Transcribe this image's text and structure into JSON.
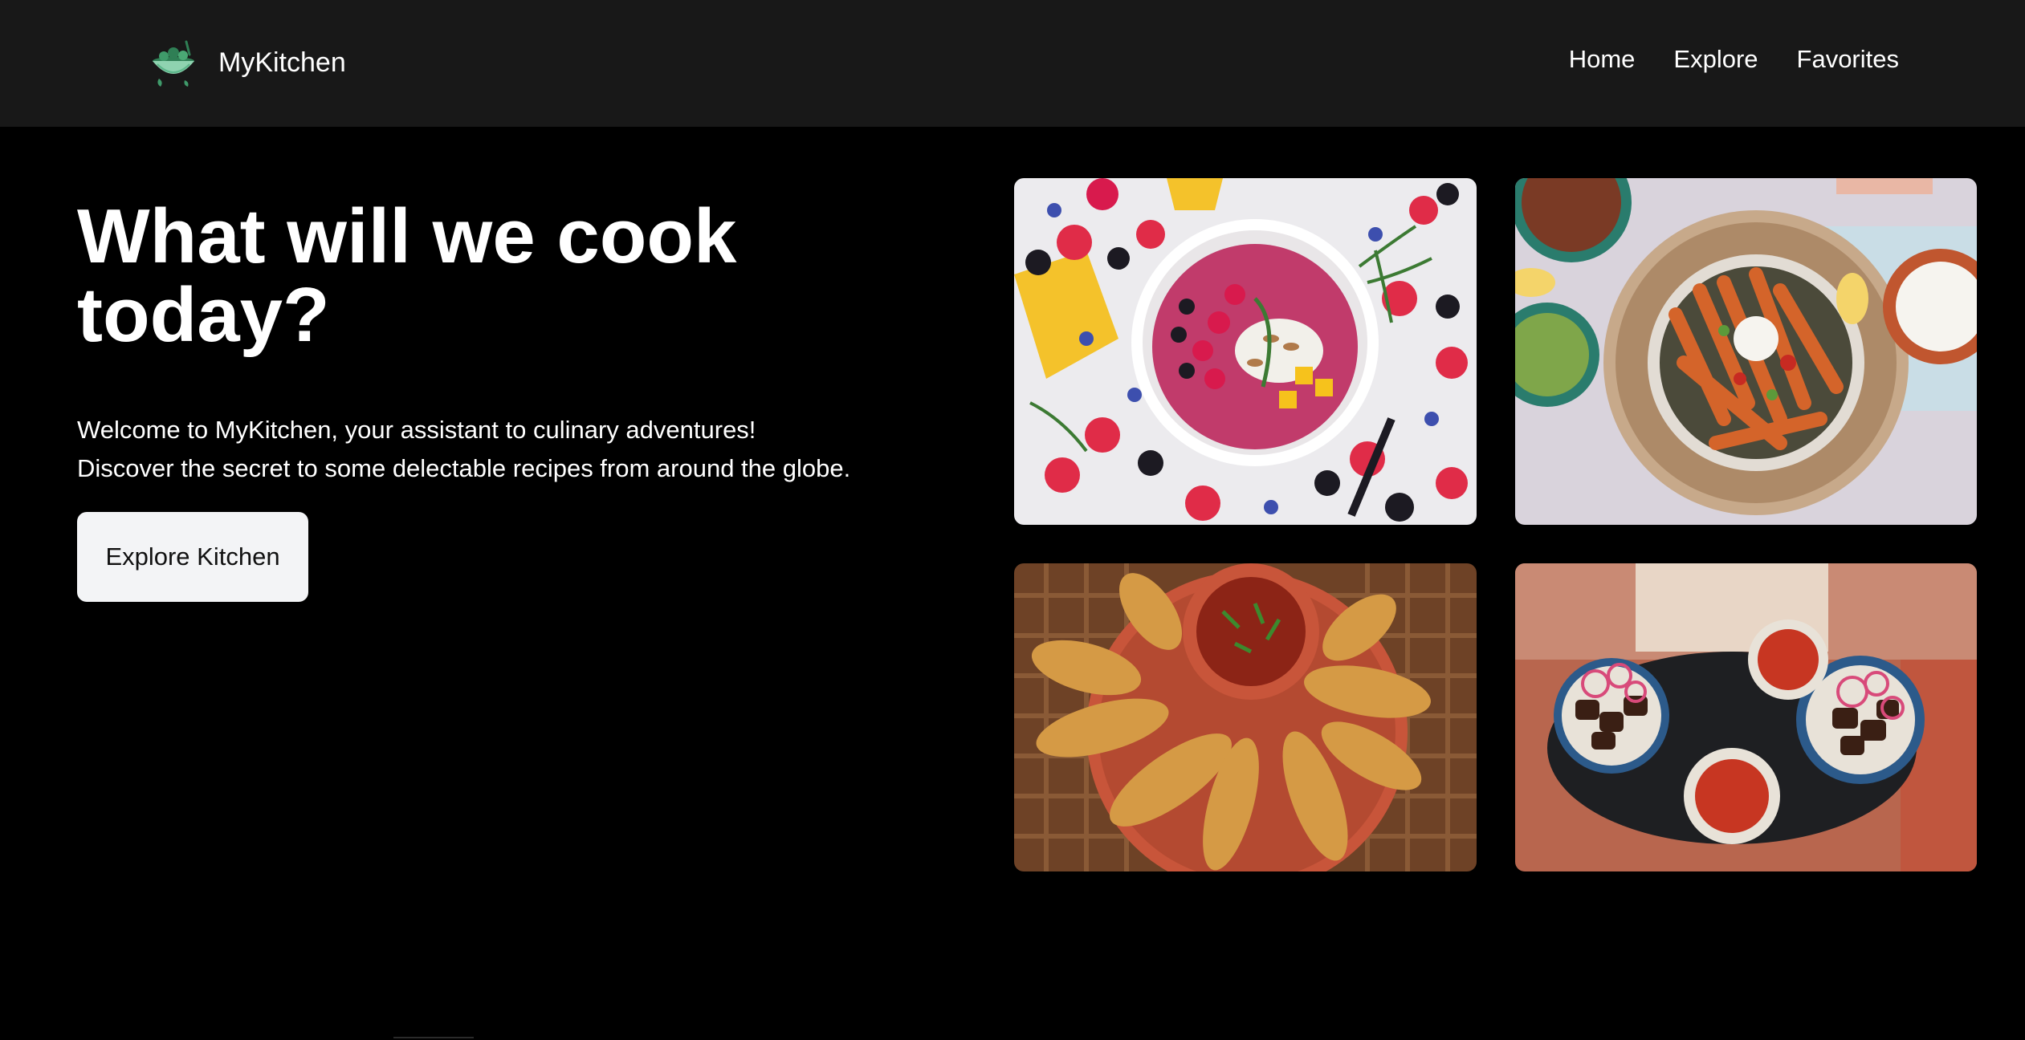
{
  "brand": {
    "name": "MyKitchen",
    "logo_icon": "salad-bowl-icon",
    "accent_color": "#3f9a6a"
  },
  "nav": {
    "items": [
      {
        "label": "Home"
      },
      {
        "label": "Explore"
      },
      {
        "label": "Favorites"
      }
    ]
  },
  "hero": {
    "title": "What will we cook today?",
    "text_line1": "Welcome to MyKitchen, your assistant to culinary adventures!",
    "text_line2": "Discover the secret to some delectable recipes from around the globe.",
    "cta_label": "Explore Kitchen"
  },
  "gallery": {
    "images": [
      {
        "name": "smoothie-bowl-with-berries"
      },
      {
        "name": "sweet-potato-fries-plate"
      },
      {
        "name": "fried-rolls-with-dip"
      },
      {
        "name": "grilled-meat-with-onions"
      }
    ]
  },
  "colors": {
    "background": "#000000",
    "navbar": "#181818",
    "button": "#f3f4f6"
  }
}
